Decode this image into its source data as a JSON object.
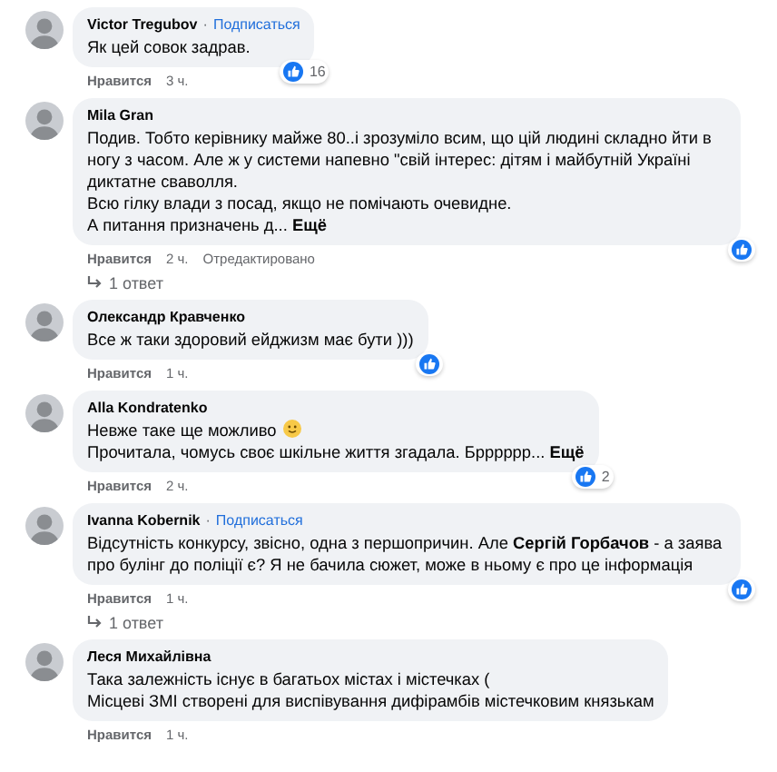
{
  "comments": [
    {
      "author": "Victor Tregubov",
      "separator": "·",
      "follow": "Подписаться",
      "paragraphs": [
        "Як цей совок задрав."
      ],
      "reaction": {
        "kind": "like",
        "count": "16"
      },
      "meta": {
        "like": "Нравится",
        "time": "3 ч."
      }
    },
    {
      "author": "Mila Gran",
      "paragraphs": [
        "Подив. Тобто керівнику майже 80..і зрозуміло всим, що цій людині складно йти в ногу з часом. Але ж у системи напевно \"свій інтерес: дітям і майбутній Україні диктатне сваволля.",
        "Всю гілку влади з посад, якщо не помічають очевидне.",
        "А питання призначень д..."
      ],
      "more": "Ещё",
      "reaction": {
        "kind": "like"
      },
      "meta": {
        "like": "Нравится",
        "time": "2 ч.",
        "edited": "Отредактировано"
      },
      "replies": "1 ответ"
    },
    {
      "author": "Олександр Кравченко",
      "paragraphs": [
        "Все ж таки здоровий ейджизм має бути )))"
      ],
      "reaction": {
        "kind": "like"
      },
      "meta": {
        "like": "Нравится",
        "time": "1 ч."
      }
    },
    {
      "author": "Alla Kondratenko",
      "paragraphs": [
        "Невже таке ще можливо",
        "Прочитала, чомусь своє шкільне життя згадала. Брррррр..."
      ],
      "emoji_after_first": true,
      "more": "Ещё",
      "reaction": {
        "kind": "like",
        "count": "2"
      },
      "meta": {
        "like": "Нравится",
        "time": "2 ч."
      }
    },
    {
      "author": "Ivanna Kobernik",
      "separator": "·",
      "follow": "Подписаться",
      "paragraphs": [
        "Відсутність конкурсу, звісно, одна з першопричин. Але **Сергій Горбачов** - а заява про булінг до поліції є? Я не бачила сюжет, може в ньому є про це інформація"
      ],
      "reaction": {
        "kind": "like"
      },
      "meta": {
        "like": "Нравится",
        "time": "1 ч."
      },
      "replies": "1 ответ"
    },
    {
      "author": "Леся Михайлівна",
      "paragraphs": [
        "Така залежність існує в багатьох містах і містечках (",
        "Місцеві ЗМІ створені для виспівування дифірамбів містечковим князькам"
      ],
      "meta": {
        "like": "Нравится",
        "time": "1 ч."
      }
    }
  ]
}
